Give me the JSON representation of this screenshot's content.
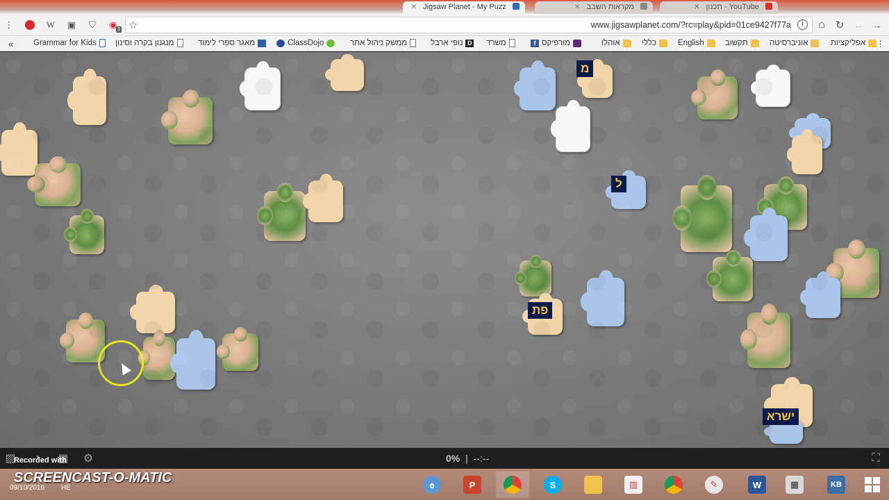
{
  "tabs": [
    {
      "title": "Jigsaw Planet - My Puzz",
      "active": true
    },
    {
      "title": "מקראות השבב",
      "active": false
    },
    {
      "title": "YouTube - תכנון",
      "active": false
    }
  ],
  "toolbar": {
    "url": "www.jigsawplanet.com/?rc=play&pid=01ce9427f77a",
    "extension_badge": "3"
  },
  "bookmarks": [
    {
      "label": "Grammar for Kids",
      "icon": "page-icon"
    },
    {
      "label": "מנגנון בקרה וסינון",
      "icon": "page-icon"
    },
    {
      "label": "מאגר ספרי לימוד",
      "icon": "book-icon"
    },
    {
      "label": "ClassDojo",
      "icon": "classdojo-icon"
    },
    {
      "label": "ממשק ניהול אתר",
      "icon": "page-icon"
    },
    {
      "label": "נופי ארבל",
      "icon": "d-icon"
    },
    {
      "label": "משרד",
      "icon": "page-icon"
    },
    {
      "label": "מורפיקס",
      "icon": "facebook-icon"
    },
    {
      "label": "אוהלו",
      "icon": "folder-icon"
    },
    {
      "label": "כללי",
      "icon": "folder-icon"
    },
    {
      "label": "English",
      "icon": "folder-icon"
    },
    {
      "label": "תקשוב",
      "icon": "folder-icon"
    },
    {
      "label": "אוניברסיטה",
      "icon": "folder-icon"
    },
    {
      "label": "אפליקציות",
      "icon": "folder-icon"
    }
  ],
  "puzzle": {
    "labels": [
      "מ",
      "ל",
      "פת",
      "ישרא"
    ],
    "progress": "0%",
    "separator": "|",
    "timer": "--:--"
  },
  "recorder": {
    "recorded_with": "Recorded with",
    "brand": "SCREENCAST-O-MATIC"
  },
  "system": {
    "date": "09/10/2016",
    "lang": "HE"
  }
}
